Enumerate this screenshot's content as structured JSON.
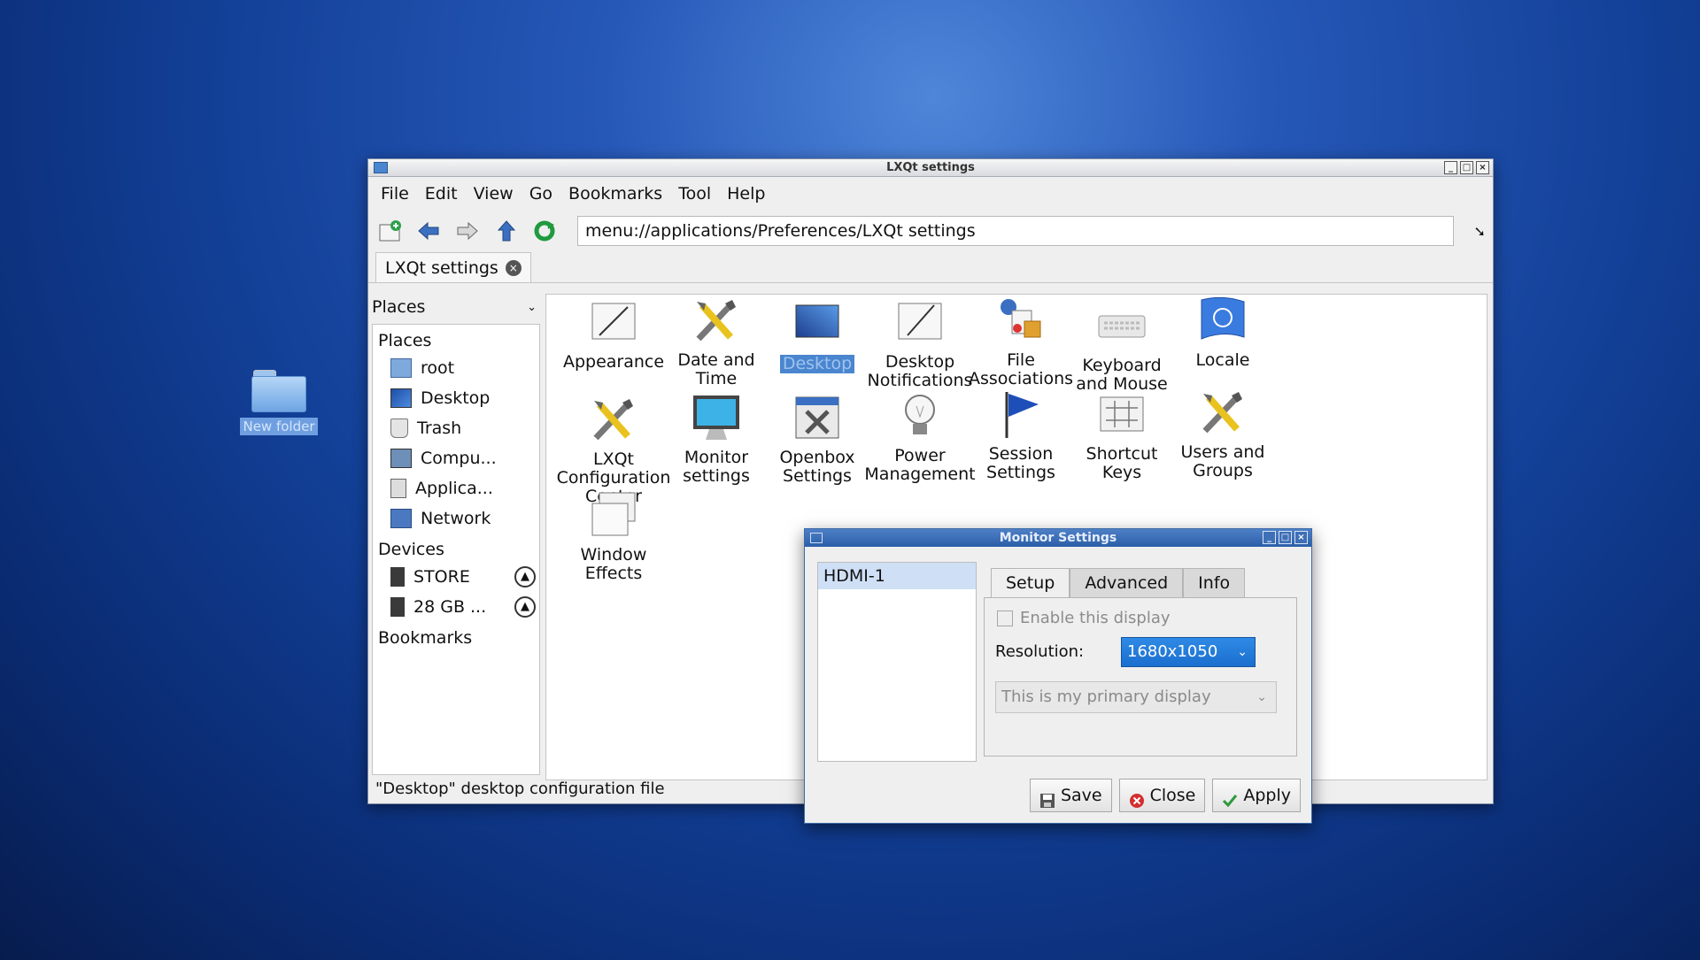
{
  "desktop": {
    "folder_label": "New folder"
  },
  "window": {
    "title": "LXQt settings",
    "menu": [
      "File",
      "Edit",
      "View",
      "Go",
      "Bookmarks",
      "Tool",
      "Help"
    ],
    "address": "menu://applications/Preferences/LXQt settings",
    "tab_label": "LXQt settings",
    "sidebar": {
      "header": "Places",
      "places_title": "Places",
      "places": [
        "root",
        "Desktop",
        "Trash",
        "Compu...",
        "Applica...",
        "Network"
      ],
      "devices_title": "Devices",
      "devices": [
        "STORE",
        "28 GB ..."
      ],
      "bookmarks_title": "Bookmarks"
    },
    "items": [
      {
        "label": "Appearance",
        "icon": "appearance-icon"
      },
      {
        "label": "Date and\nTime",
        "icon": "tools-icon"
      },
      {
        "label": "Desktop",
        "icon": "desktop-icon",
        "selected": true
      },
      {
        "label": "Desktop\nNotifications",
        "icon": "notifications-icon"
      },
      {
        "label": "File\nAssociations",
        "icon": "file-associations-icon"
      },
      {
        "label": "Keyboard\nand Mouse",
        "icon": "keyboard-icon"
      },
      {
        "label": "Locale",
        "icon": "un-flag-icon"
      },
      {
        "label": "LXQt\nConfiguration\nCenter",
        "icon": "tools-icon"
      },
      {
        "label": "Monitor\nsettings",
        "icon": "monitor-icon"
      },
      {
        "label": "Openbox\nSettings",
        "icon": "openbox-icon"
      },
      {
        "label": "Power\nManagement",
        "icon": "lightbulb-icon"
      },
      {
        "label": "Session\nSettings",
        "icon": "flag-icon"
      },
      {
        "label": "Shortcut\nKeys",
        "icon": "keys-icon"
      },
      {
        "label": "Users and\nGroups",
        "icon": "tools-icon"
      },
      {
        "label": "Window\nEffects",
        "icon": "windows-icon"
      }
    ],
    "status": "\"Desktop\" desktop configuration file"
  },
  "dialog": {
    "title": "Monitor Settings",
    "outputs": [
      "HDMI-1"
    ],
    "tabs": [
      "Setup",
      "Advanced",
      "Info"
    ],
    "enable_label": "Enable this display",
    "resolution_label": "Resolution:",
    "resolution_value": "1680x1050",
    "primary_value": "This is my primary display",
    "buttons": {
      "save": "Save",
      "close": "Close",
      "apply": "Apply"
    }
  }
}
